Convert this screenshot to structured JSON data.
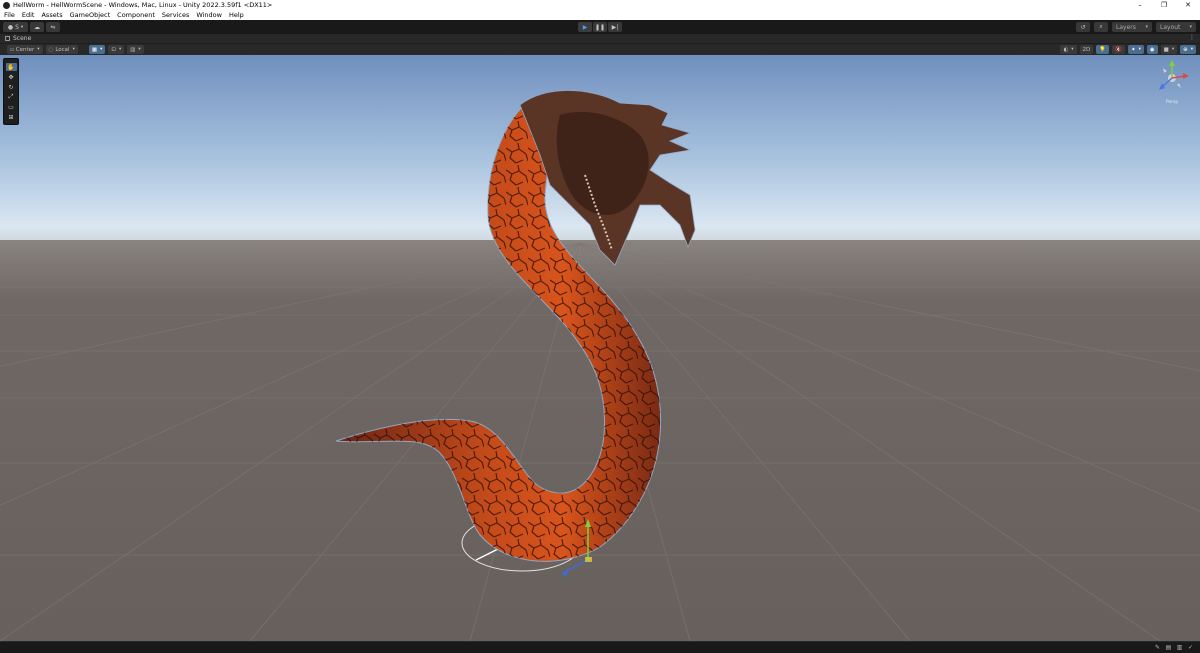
{
  "window": {
    "title": "HellWorm - HellWormScene - Windows, Mac, Linux - Unity 2022.3.59f1 <DX11>",
    "minimize": "–",
    "restore": "❐",
    "close": "✕"
  },
  "menu": [
    "File",
    "Edit",
    "Assets",
    "GameObject",
    "Component",
    "Services",
    "Window",
    "Help"
  ],
  "toolbar": {
    "account_label": "S",
    "layers_label": "Layers",
    "layout_label": "Layout"
  },
  "scene_tab": {
    "label": "Scene",
    "more": "⋮"
  },
  "scene_toolbar": {
    "pivot_label": "Center",
    "space_label": "Local",
    "mode_2d": "2D"
  },
  "gizmo": {
    "projection_label": "Persp"
  },
  "colors": {
    "accent": "#4a6d92",
    "play_blue": "#4d9df0",
    "sky_top": "#6f8fbd",
    "horizon": "#d9e6f2",
    "ground": "#6e6763",
    "worm_dark": "#3b1a12",
    "worm_bright": "#d8541c"
  },
  "icons": {
    "play": "play-icon",
    "pause": "pause-icon",
    "step": "step-icon",
    "cloud": "cloud-icon",
    "history": "history-icon",
    "search": "search-icon"
  }
}
